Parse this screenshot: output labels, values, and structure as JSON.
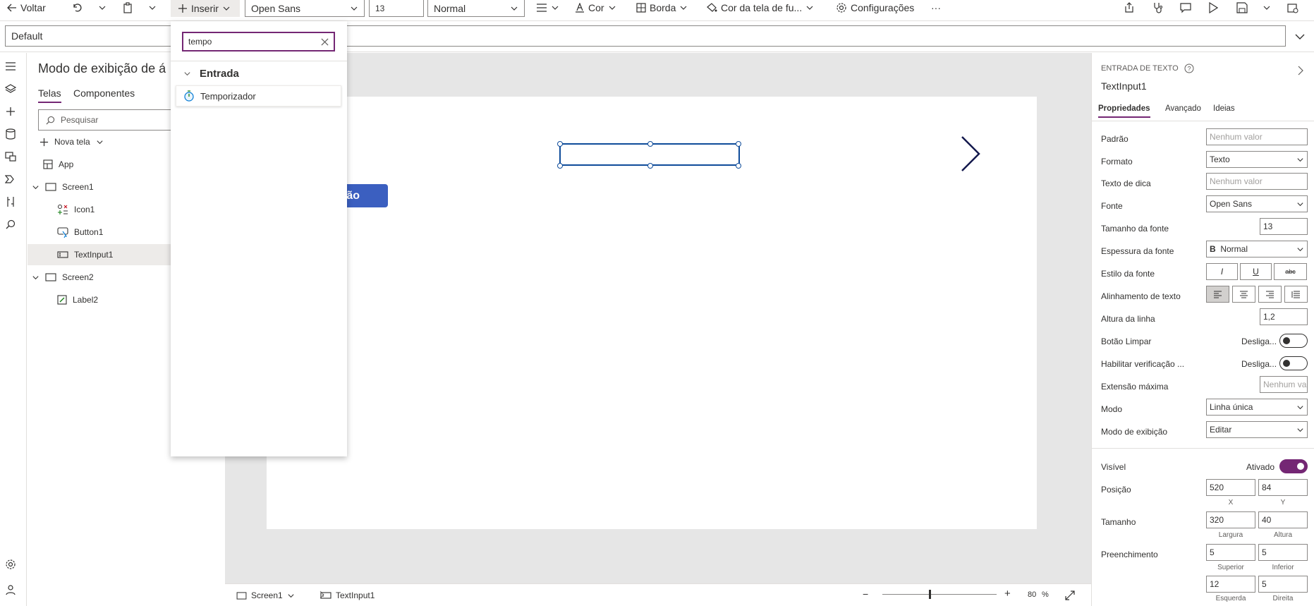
{
  "toolbar": {
    "back": "Voltar",
    "insert": "Inserir",
    "font": "Open Sans",
    "font_size": "13",
    "weight": "Normal",
    "color": "Cor",
    "border": "Borda",
    "fill": "Cor da tela de fu...",
    "settings": "Configurações",
    "more": "···"
  },
  "formula": {
    "property": "Default"
  },
  "tree": {
    "title": "Modo de exibição de á",
    "tabs": [
      "Telas",
      "Componentes"
    ],
    "search_placeholder": "Pesquisar",
    "new_screen": "Nova tela",
    "items": [
      "App",
      "Screen1",
      "Icon1",
      "Button1",
      "TextInput1",
      "Screen2",
      "Label2"
    ]
  },
  "insert_panel": {
    "search_value": "tempo",
    "group": "Entrada",
    "result": "Temporizador"
  },
  "canvas": {
    "button_text": "ão"
  },
  "status": {
    "screen": "Screen1",
    "control": "TextInput1",
    "zoom": "80",
    "zoom_unit": "%"
  },
  "props": {
    "type_label": "ENTRADA DE TEXTO",
    "control_name": "TextInput1",
    "tabs": [
      "Propriedades",
      "Avançado",
      "Ideias"
    ],
    "labels": {
      "padrao": "Padrão",
      "formato": "Formato",
      "dica": "Texto de dica",
      "fonte": "Fonte",
      "tamanho_fonte": "Tamanho da fonte",
      "espessura": "Espessura da fonte",
      "estilo": "Estilo da fonte",
      "alinhamento": "Alinhamento de texto",
      "altura_linha": "Altura da linha",
      "botao_limpar": "Botão Limpar",
      "verificacao": "Habilitar verificação ...",
      "extensao": "Extensão máxima",
      "modo": "Modo",
      "modo_exibicao": "Modo de exibição",
      "visivel": "Visível",
      "posicao": "Posição",
      "tamanho": "Tamanho",
      "preenchimento": "Preenchimento"
    },
    "values": {
      "padrao_ph": "Nenhum valor",
      "formato": "Texto",
      "dica_ph": "Nenhum valor",
      "fonte": "Open Sans",
      "tamanho_fonte": "13",
      "espessura": "Normal",
      "altura_linha": "1,2",
      "botao_limpar": "Desliga...",
      "verificacao": "Desliga...",
      "extensao_ph": "Nenhum val",
      "modo": "Linha única",
      "modo_exibicao": "Editar",
      "visivel": "Ativado",
      "x": "520",
      "y": "84",
      "largura": "320",
      "altura": "40",
      "superior": "5",
      "inferior": "5",
      "esquerda": "12",
      "direita": "5"
    },
    "sublabels": {
      "x": "X",
      "y": "Y",
      "largura": "Largura",
      "altura": "Altura",
      "superior": "Superior",
      "inferior": "Inferior",
      "esquerda": "Esquerda",
      "direita": "Direita"
    },
    "style_glyphs": {
      "italic": "I",
      "underline": "U",
      "strike": "abc",
      "bold": "B"
    }
  },
  "colors": {
    "accent": "#742774",
    "button": "#3b5fc0",
    "selection": "#0f4c9a",
    "canvas_bg": "#e6e6e6"
  }
}
